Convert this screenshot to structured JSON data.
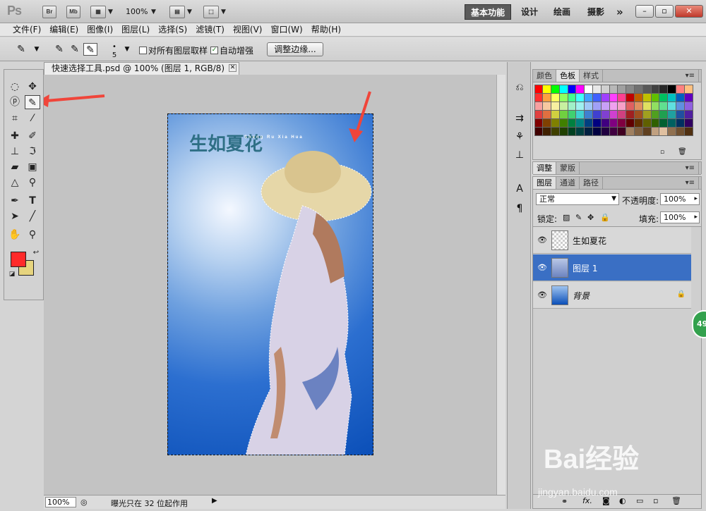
{
  "appbar": {
    "logo": "Ps",
    "bridge": "Br",
    "minibridge": "Mb",
    "zoom": "100%",
    "workspaces": [
      "基本功能",
      "设计",
      "绘画",
      "摄影"
    ],
    "more": "»"
  },
  "menu": [
    "文件(F)",
    "编辑(E)",
    "图像(I)",
    "图层(L)",
    "选择(S)",
    "滤镜(T)",
    "视图(V)",
    "窗口(W)",
    "帮助(H)"
  ],
  "options": {
    "brush_size": "5",
    "sample_all_layers": "对所有图层取样",
    "sample_all_checked": false,
    "auto_enhance": "自动增强",
    "auto_enhance_checked": true,
    "refine_edge": "调整边缘..."
  },
  "document": {
    "tab_title": "快速选择工具.psd @ 100% (图层 1, RGB/8)",
    "photo_title": "生如夏花",
    "photo_subtitle": "Sheng Ru Xia Hua",
    "status_zoom": "100%",
    "status_text": "曝光只在 32 位起作用"
  },
  "swatches_panel": {
    "tabs": [
      "颜色",
      "色板",
      "样式"
    ],
    "active": "色板"
  },
  "adjust_panel": {
    "tabs": [
      "调整",
      "蒙版"
    ]
  },
  "layers_panel": {
    "tabs": [
      "图层",
      "通道",
      "路径"
    ],
    "blend_mode": "正常",
    "opacity_label": "不透明度:",
    "opacity": "100%",
    "lock_label": "锁定:",
    "fill_label": "填充:",
    "fill": "100%",
    "layers": [
      {
        "name": "生如夏花",
        "selected": false
      },
      {
        "name": "图层 1",
        "selected": true
      },
      {
        "name": "背景",
        "selected": false
      }
    ]
  },
  "colors": {
    "foreground": "#ff2a2a",
    "background": "#e6d47e",
    "selected_layer": "#3a6fc4"
  },
  "watermark": {
    "brand": "Bai经验",
    "url": "jingyan.baidu.com"
  },
  "badge": "49"
}
